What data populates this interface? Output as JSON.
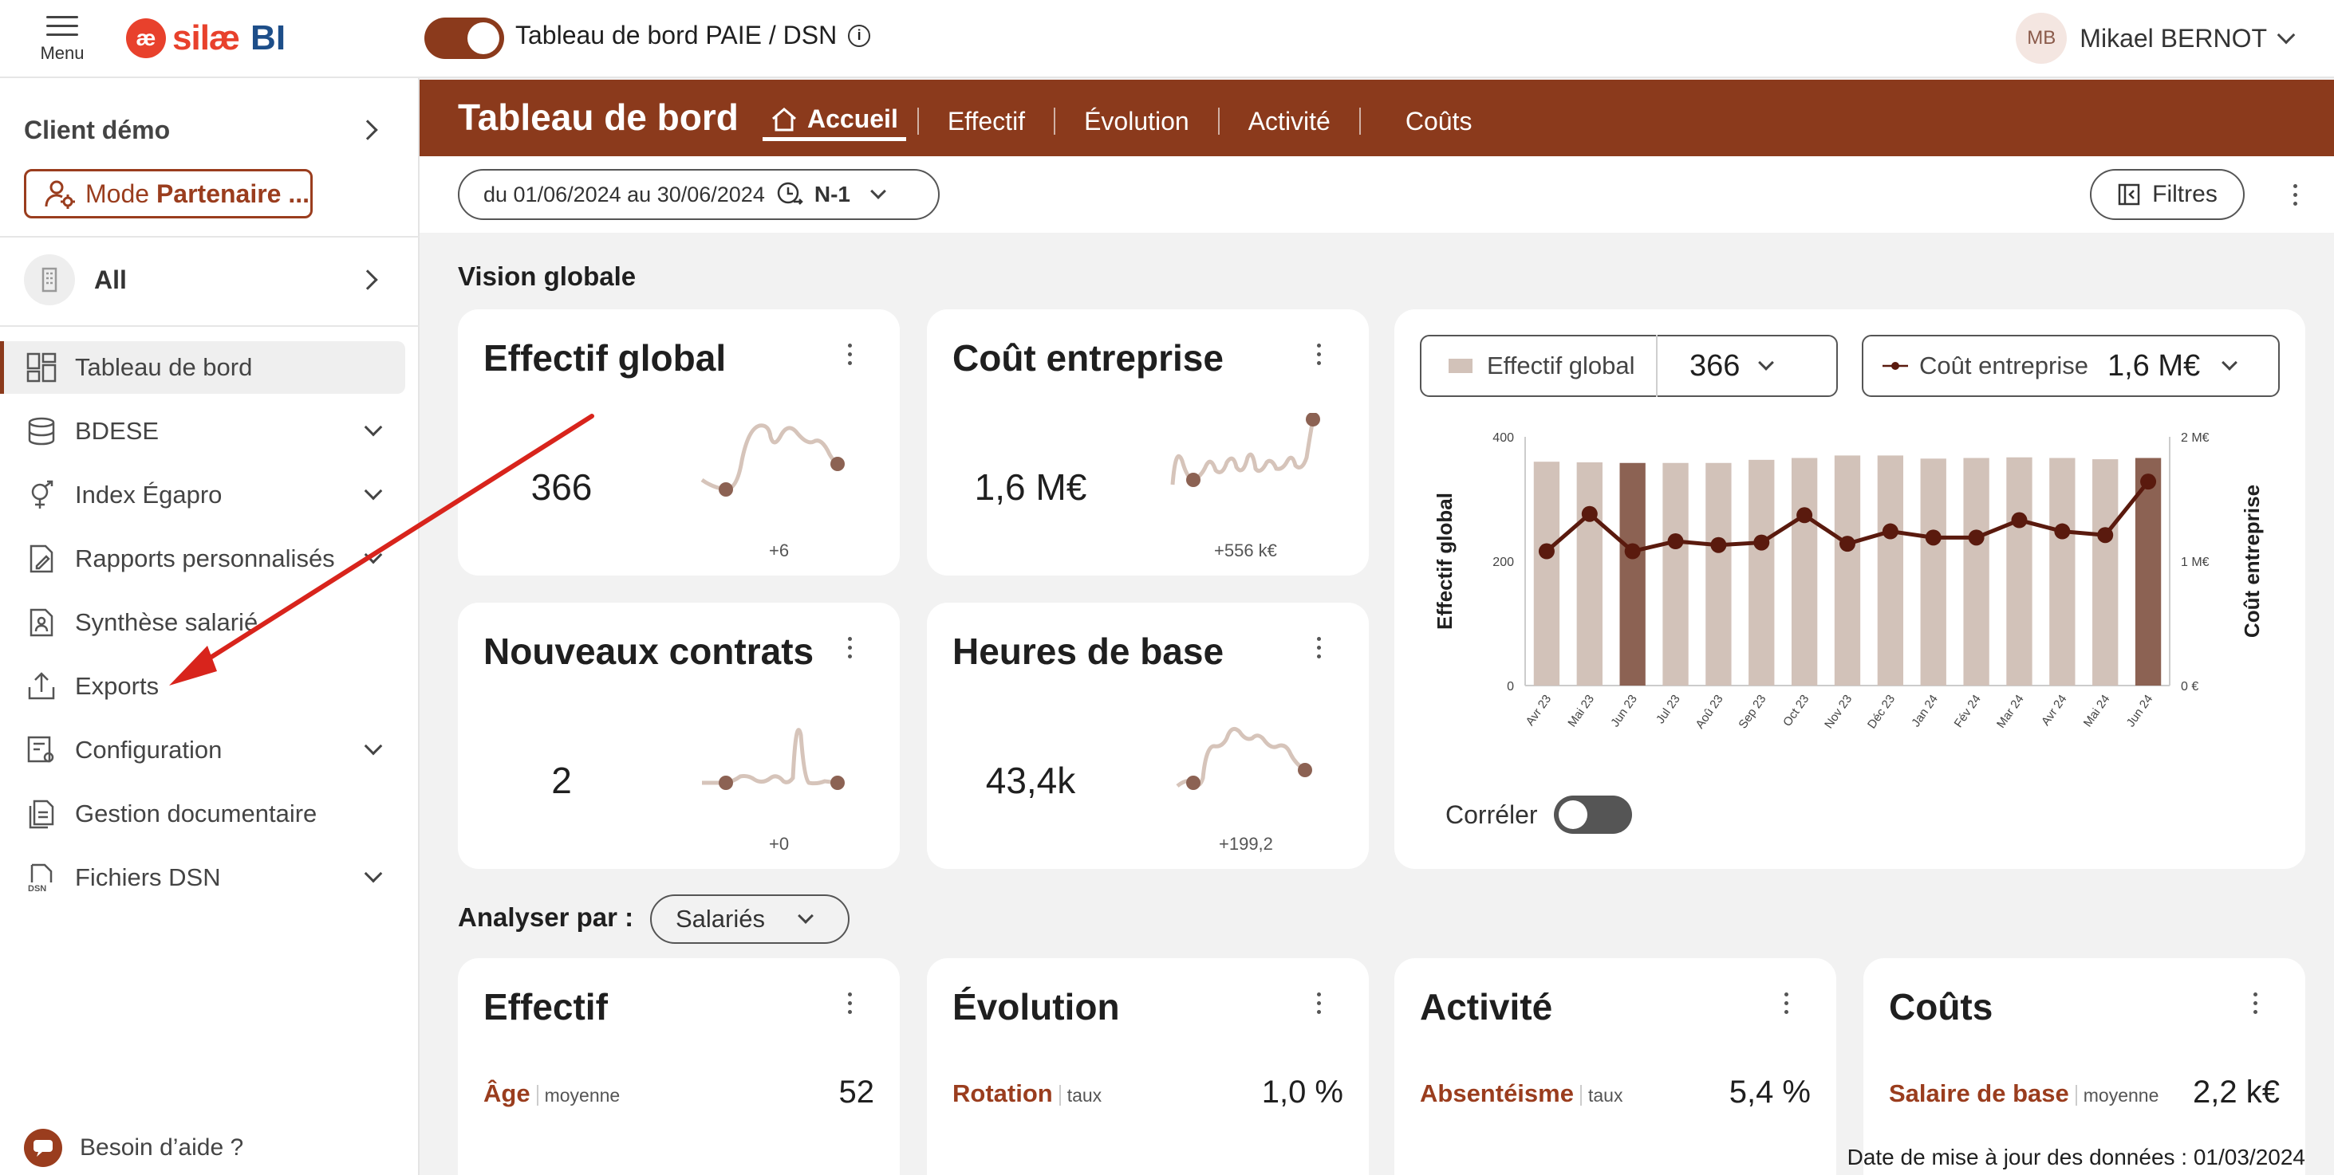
{
  "topbar": {
    "menu_label": "Menu",
    "logo_text": "silæ",
    "logo_bi": "BI",
    "dashboard_title": "Tableau de bord PAIE / DSN",
    "user_initials": "MB",
    "user_name": "Mikael BERNOT"
  },
  "sidebar": {
    "client_label": "Client démo",
    "mode_prefix": "Mode ",
    "mode_bold": "Partenaire ...",
    "all_label": "All",
    "items": [
      {
        "label": "Tableau de bord",
        "icon": "dashboard-icon",
        "active": true,
        "expandable": false
      },
      {
        "label": "BDESE",
        "icon": "database-icon",
        "active": false,
        "expandable": true
      },
      {
        "label": "Index Égapro",
        "icon": "gender-icon",
        "active": false,
        "expandable": true
      },
      {
        "label": "Rapports personnalisés",
        "icon": "report-edit-icon",
        "active": false,
        "expandable": true
      },
      {
        "label": "Synthèse salarié",
        "icon": "employee-file-icon",
        "active": false,
        "expandable": false
      },
      {
        "label": "Exports",
        "icon": "export-icon",
        "active": false,
        "expandable": false
      },
      {
        "label": "Configuration",
        "icon": "config-icon",
        "active": false,
        "expandable": true
      },
      {
        "label": "Gestion documentaire",
        "icon": "documents-icon",
        "active": false,
        "expandable": false
      },
      {
        "label": "Fichiers DSN",
        "icon": "dsn-file-icon",
        "active": false,
        "expandable": true
      }
    ],
    "help_label": "Besoin d’aide ?"
  },
  "header": {
    "title": "Tableau de bord",
    "tabs": [
      "Accueil",
      "Effectif",
      "Évolution",
      "Activité",
      "Coûts"
    ]
  },
  "filters": {
    "date_range": "du 01/06/2024 au 30/06/2024",
    "compare": "N-1",
    "filters_label": "Filtres"
  },
  "vision": {
    "section_title": "Vision globale",
    "cards": [
      {
        "title": "Effectif global",
        "value": "366",
        "delta": "+6"
      },
      {
        "title": "Coût entreprise",
        "value": "1,6 M€",
        "delta": "+556 k€"
      },
      {
        "title": "Nouveaux contrats",
        "value": "2",
        "delta": "+0"
      },
      {
        "title": "Heures de base",
        "value": "43,4k",
        "delta": "+199,2"
      }
    ]
  },
  "chart_panel": {
    "legend_bar_name": "Effectif global",
    "legend_bar_value": "366",
    "legend_line_name": "Coût entreprise",
    "legend_line_value": "1,6 M€",
    "correler_label": "Corréler",
    "colors": {
      "bar": "#d2c2b9",
      "bar_highlight": "#8c6253",
      "line": "#5a1a0e"
    }
  },
  "chart_data": {
    "type": "bar",
    "categories": [
      "Avr 23",
      "Mai 23",
      "Jun 23",
      "Jul 23",
      "Aoû 23",
      "Sep 23",
      "Oct 23",
      "Nov 23",
      "Déc 23",
      "Jan 24",
      "Fév 24",
      "Mar 24",
      "Avr 24",
      "Mai 24",
      "Jun 24"
    ],
    "series": [
      {
        "name": "Effectif global",
        "type": "bar",
        "axis": "left",
        "values": [
          360,
          359,
          358,
          358,
          358,
          363,
          366,
          370,
          370,
          365,
          366,
          367,
          366,
          364,
          366
        ]
      },
      {
        "name": "Coût entreprise",
        "type": "line",
        "axis": "right",
        "values": [
          1.08,
          1.38,
          1.08,
          1.16,
          1.13,
          1.15,
          1.37,
          1.14,
          1.24,
          1.19,
          1.19,
          1.33,
          1.24,
          1.21,
          1.64
        ]
      }
    ],
    "highlight_categories": [
      "Jun 23",
      "Jun 24"
    ],
    "ylabel": "Effectif global",
    "y2label": "Coût entreprise",
    "ylim": [
      0,
      400
    ],
    "yticks": [
      "0",
      "200",
      "400"
    ],
    "y2lim": [
      0,
      2
    ],
    "y2ticks": [
      "0 €",
      "1 M€",
      "2 M€"
    ]
  },
  "analyse": {
    "label": "Analyser par :",
    "selected": "Salariés",
    "cards": [
      {
        "title": "Effectif",
        "metric": "Âge",
        "sub": "moyenne",
        "value": "52"
      },
      {
        "title": "Évolution",
        "metric": "Rotation",
        "sub": "taux",
        "value": "1,0 %"
      },
      {
        "title": "Activité",
        "metric": "Absentéisme",
        "sub": "taux",
        "value": "5,4 %"
      },
      {
        "title": "Coûts",
        "metric": "Salaire de base",
        "sub": "moyenne",
        "value": "2,2 k€"
      }
    ]
  },
  "footer": {
    "updated": "Date de mise à jour des données : 01/03/2024"
  }
}
